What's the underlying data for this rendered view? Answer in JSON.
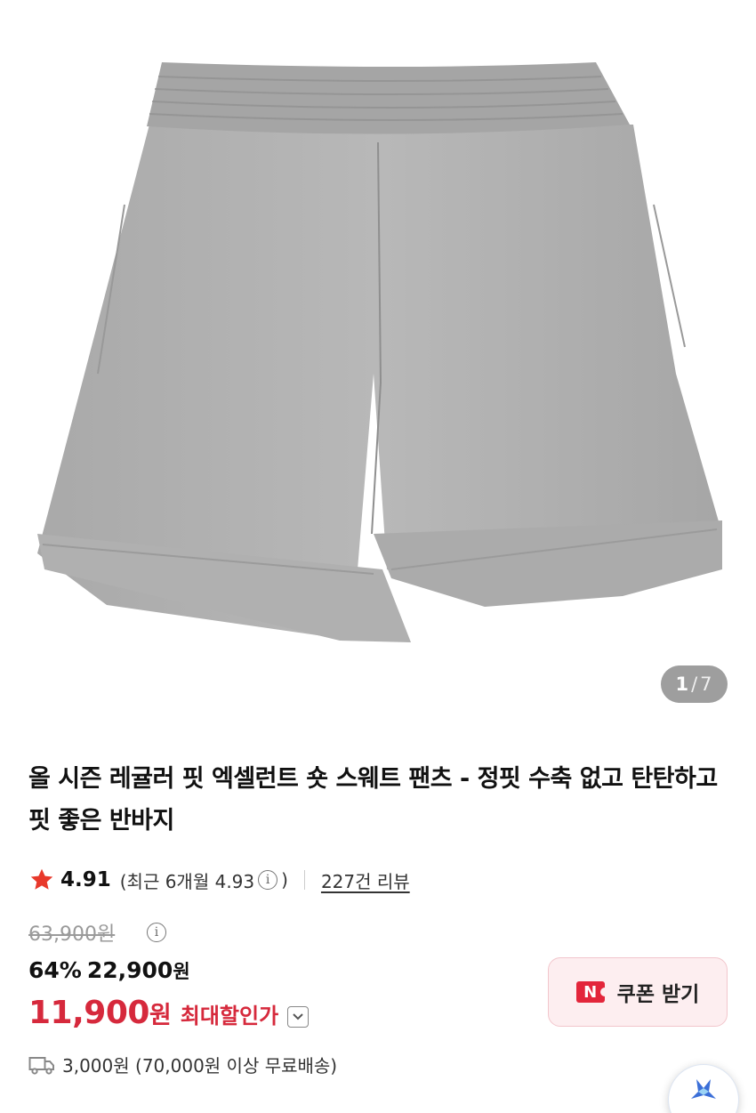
{
  "gallery": {
    "current_page": "1",
    "separator": "/",
    "total_pages": "7",
    "image_icon": "grey-sweat-shorts-image"
  },
  "product": {
    "title": "올 시즌 레귤러 핏 엑셀런트 숏 스웨트 팬츠 - 정핏 수축 없고 탄탄하고 핏 좋은 반바지"
  },
  "rating": {
    "star_icon": "star-icon",
    "star_color": "#e8392b",
    "score": "4.91",
    "recent_prefix": "(최근 6개월 4.93",
    "recent_suffix": ")",
    "reviews": "227건 리뷰"
  },
  "price": {
    "original": "63,900원",
    "discount_percent": "64%",
    "sale_price": "22,900",
    "sale_currency": "원",
    "max_price": "11,900",
    "max_currency": "원",
    "max_label": "최대할인가",
    "accent_color": "#d6293c"
  },
  "coupon": {
    "badge": "N",
    "label": "쿠폰 받기"
  },
  "shipping": {
    "icon": "truck-icon",
    "text": "3,000원 (70,000원 이상 무료배송)"
  }
}
